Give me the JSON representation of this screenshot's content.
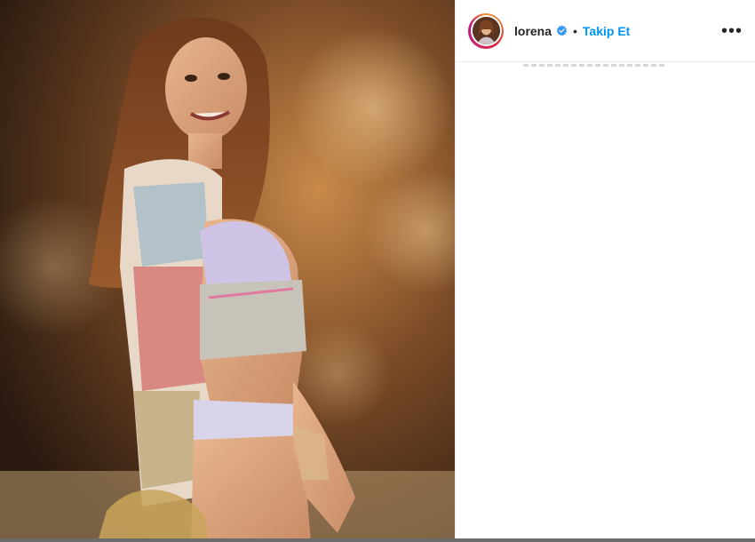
{
  "post": {
    "username": "lorena",
    "verified_icon": "verified-badge-icon",
    "separator": "•",
    "follow_label": "Takip Et",
    "more_icon": "more-options-icon",
    "more_label": "•••"
  },
  "colors": {
    "follow_blue": "#0095f6",
    "text_dark": "#262626",
    "verified_blue": "#3897f0",
    "divider": "#efefef"
  }
}
